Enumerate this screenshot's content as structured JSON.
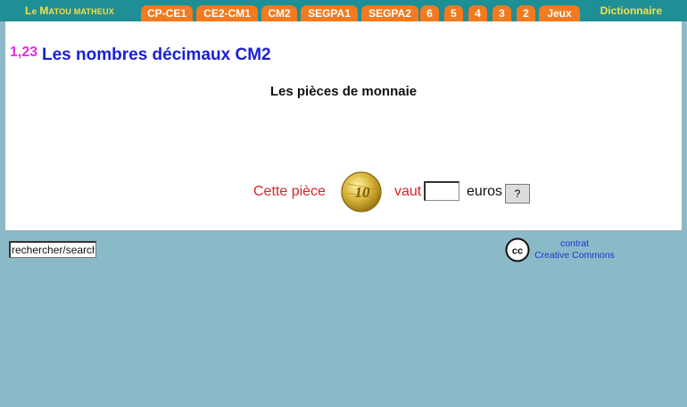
{
  "brand": {
    "initial1": "L",
    "rest1": "e ",
    "initial2": "M",
    "rest2": "atou matheux"
  },
  "tabs": [
    "CP-CE1",
    "CE2-CM1",
    "CM2",
    "SEGPA1",
    "SEGPA2",
    "6",
    "5",
    "4",
    "3",
    "2",
    "Jeux"
  ],
  "dictionary_label": "Dictionnaire",
  "lesson": {
    "badge": "1,23",
    "title": "Les nombres décimaux CM2",
    "subtitle": "Les pièces de monnaie"
  },
  "exercise": {
    "prompt_before": "Cette pièce",
    "prompt_after": "vaut",
    "answer_value": "",
    "unit": "euros",
    "check_label": "?",
    "coin_value": "10",
    "coin_icon": "ten-cent-coin-icon"
  },
  "footer": {
    "search_value": "rechercher/search",
    "license_line1": "contrat",
    "license_line2": "Creative Commons",
    "license_icon": "creative-commons-icon"
  },
  "colors": {
    "background": "#8abac8",
    "topbar": "#1f8f96",
    "tab": "#f37a1e",
    "brand_text": "#f2e04a",
    "title": "#1a1fd6",
    "badge": "#e62be0",
    "prompt": "#d8232a"
  }
}
